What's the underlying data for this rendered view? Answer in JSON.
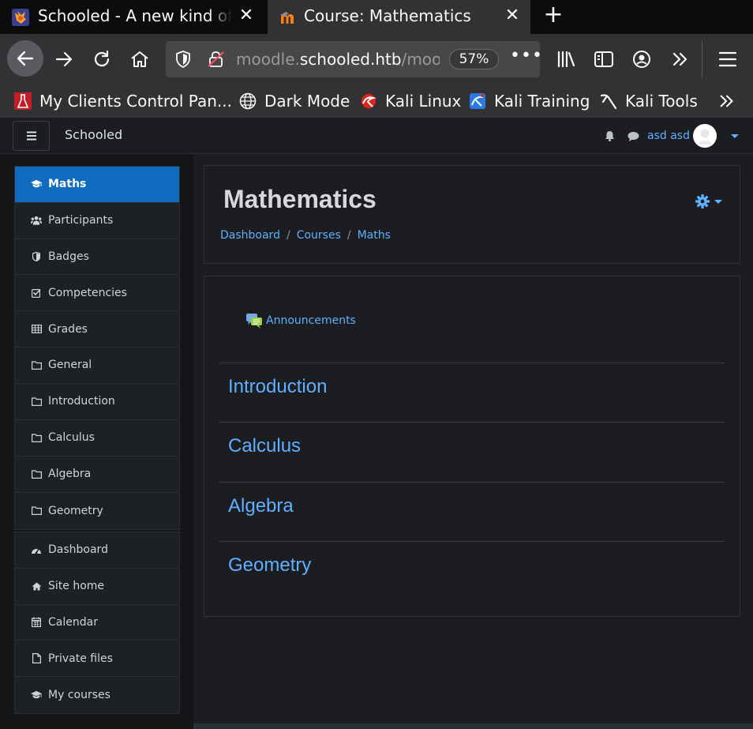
{
  "browser": {
    "tabs": [
      {
        "title": "Schooled - A new kind of educational",
        "active": false
      },
      {
        "title": "Course: Mathematics",
        "active": true
      }
    ],
    "url": {
      "prefix": "moodle.",
      "domain": "schooled.htb",
      "path": "/moodle/course/view.php"
    },
    "zoom": "57%",
    "bookmarks": [
      {
        "label": "My Clients Control Pan...",
        "icon": "flask-icon"
      },
      {
        "label": "Dark Mode",
        "icon": "globe-icon"
      },
      {
        "label": "Kali Linux",
        "icon": "kali-icon"
      },
      {
        "label": "Kali Training",
        "icon": "kali-training-icon"
      },
      {
        "label": "Kali Tools",
        "icon": "kali-tools-icon"
      }
    ]
  },
  "header": {
    "site_name": "Schooled",
    "user_name": "asd asd"
  },
  "sidebar": {
    "course_nav": [
      {
        "label": "Maths",
        "icon": "graduation-cap-icon",
        "active": true
      },
      {
        "label": "Participants",
        "icon": "users-icon"
      },
      {
        "label": "Badges",
        "icon": "shield-icon"
      },
      {
        "label": "Competencies",
        "icon": "check-square-icon"
      },
      {
        "label": "Grades",
        "icon": "table-icon"
      },
      {
        "label": "General",
        "icon": "folder-icon"
      },
      {
        "label": "Introduction",
        "icon": "folder-icon"
      },
      {
        "label": "Calculus",
        "icon": "folder-icon"
      }
    ],
    "sections_nav": [
      {
        "label": "Algebra",
        "icon": "folder-icon"
      },
      {
        "label": "Geometry",
        "icon": "folder-icon"
      }
    ],
    "site_nav": [
      {
        "label": "Dashboard",
        "icon": "dashboard-icon"
      },
      {
        "label": "Site home",
        "icon": "home-icon"
      },
      {
        "label": "Calendar",
        "icon": "calendar-icon"
      },
      {
        "label": "Private files",
        "icon": "file-icon"
      },
      {
        "label": "My courses",
        "icon": "graduation-cap-icon"
      }
    ]
  },
  "main": {
    "title": "Mathematics",
    "breadcrumb": [
      "Dashboard",
      "Courses",
      "Maths"
    ],
    "announcements_label": "Announcements",
    "sections": [
      "Introduction",
      "Calculus",
      "Algebra",
      "Geometry"
    ]
  },
  "colors": {
    "accent": "#0f6cbf",
    "link": "#5fb0ff",
    "background": "#1b1d21"
  }
}
